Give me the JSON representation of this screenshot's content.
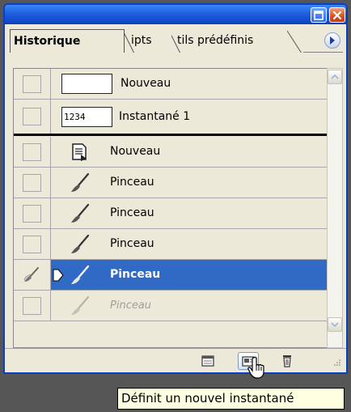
{
  "tabs": [
    {
      "label": "Historique",
      "active": true
    },
    {
      "label": "ipts",
      "active": false
    },
    {
      "label": "tils prédéfinis",
      "active": false
    }
  ],
  "snapshots": [
    {
      "thumb_text": "",
      "label": "Nouveau"
    },
    {
      "thumb_text": "1234",
      "label": "Instantané 1"
    }
  ],
  "history": [
    {
      "icon": "document-icon",
      "label": "Nouveau",
      "state": "normal"
    },
    {
      "icon": "brush-icon",
      "label": "Pinceau",
      "state": "normal"
    },
    {
      "icon": "brush-icon",
      "label": "Pinceau",
      "state": "normal"
    },
    {
      "icon": "brush-icon",
      "label": "Pinceau",
      "state": "normal"
    },
    {
      "icon": "brush-icon",
      "label": "Pinceau",
      "state": "selected"
    },
    {
      "icon": "brush-icon",
      "label": "Pinceau",
      "state": "undone"
    }
  ],
  "toolbar": {
    "buttons": [
      "new-document-from-state-icon",
      "new-snapshot-icon",
      "trash-icon"
    ]
  },
  "tooltip": {
    "text": "Définit un nouvel instantané"
  },
  "colors": {
    "titlebar": "#1f5fe0",
    "panel_bg": "#ece9d8",
    "selection": "#316ac5",
    "tooltip_bg": "#ffffe1"
  }
}
